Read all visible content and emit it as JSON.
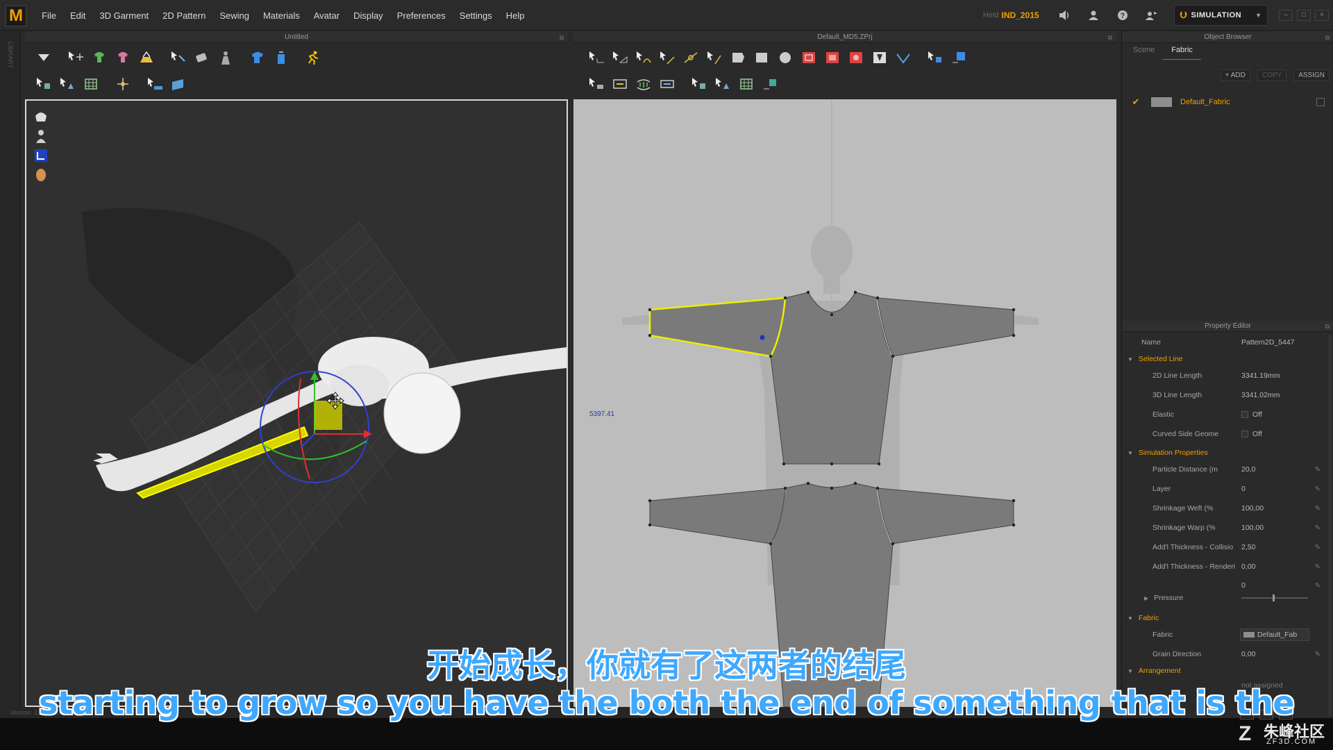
{
  "app": {
    "logo": "M",
    "menu": [
      "File",
      "Edit",
      "3D Garment",
      "2D Pattern",
      "Sewing",
      "Materials",
      "Avatar",
      "Display",
      "Preferences",
      "Settings",
      "Help"
    ],
    "held_label": "Held",
    "held_value": "IND_2015",
    "mode": "SIMULATION"
  },
  "left_strip_text": "LIBRARY",
  "panels": {
    "left_title": "Untitled",
    "center_title": "Default_MD5.ZPrj",
    "right_title": "Object Browser",
    "property_title": "Property Editor"
  },
  "viewport2d": {
    "dimension_label": "5397.41"
  },
  "object_browser": {
    "tabs": [
      "Scene",
      "Fabric"
    ],
    "active_tab": "Fabric",
    "actions": [
      "+ ADD",
      "COPY",
      "ASSIGN"
    ],
    "fabric_item": "Default_Fabric"
  },
  "property_editor": {
    "name_label": "Name",
    "name_value": "Pattern2D_5447",
    "selected_line_section": "Selected Line",
    "rows_selected": [
      {
        "name": "2D Line Length",
        "value": "3341.19mm"
      },
      {
        "name": "3D Line Length",
        "value": "3341.02mm"
      },
      {
        "name": "Elastic",
        "value": "Off"
      },
      {
        "name": "Curved Side Geome",
        "value": "Off"
      }
    ],
    "sim_section": "Simulation Properties",
    "rows_sim": [
      {
        "name": "Particle Distance (m",
        "value": "20,0"
      },
      {
        "name": "Layer",
        "value": "0"
      },
      {
        "name": "Shrinkage Weft (%",
        "value": "100,00"
      },
      {
        "name": "Shrinkage Warp (%",
        "value": "100,00"
      },
      {
        "name": "Add'l Thickness - Collisio",
        "value": "2,50"
      },
      {
        "name": "Add'l Thickness - Renderi",
        "value": "0,00"
      }
    ],
    "pressure_label": "Pressure",
    "pressure_value": "0",
    "fabric_section": "Fabric",
    "fabric_name_label": "Fabric",
    "fabric_value": "Default_Fab",
    "grain_label": "Grain Direction",
    "grain_value": "0,00",
    "arrangement_section": "Arrangement",
    "arrangement_value": "not assigned"
  },
  "status": {
    "version": "Version: 2.5.128   (r.1505)"
  },
  "subtitles": {
    "chinese": "开始成长，你就有了这两者的结尾",
    "english": "starting to grow so you have the both the end of something that is the"
  },
  "watermark": {
    "logo": "Z",
    "title": "朱峰社区",
    "site": "ZF3D.COM"
  },
  "colors": {
    "accent": "#f0a000",
    "selection": "#e8e800",
    "subtitle": "#3ea8ff"
  }
}
